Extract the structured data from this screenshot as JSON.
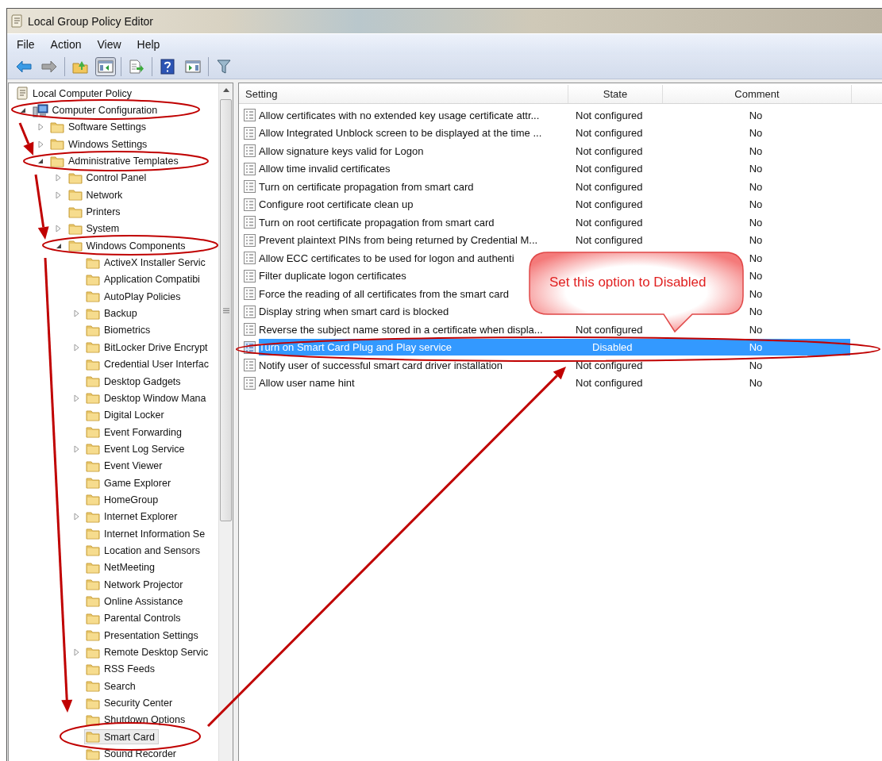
{
  "window": {
    "title": "Local Group Policy Editor"
  },
  "menu": [
    {
      "label": "File"
    },
    {
      "label": "Action"
    },
    {
      "label": "View"
    },
    {
      "label": "Help"
    }
  ],
  "toolbar": [
    [
      {
        "kind": "back",
        "pressed": false
      },
      {
        "kind": "forward",
        "pressed": false
      }
    ],
    [
      {
        "kind": "up",
        "pressed": false
      },
      {
        "kind": "tree",
        "pressed": true
      }
    ],
    [
      {
        "kind": "export",
        "pressed": false
      }
    ],
    [
      {
        "kind": "help",
        "pressed": false
      },
      {
        "kind": "pane",
        "pressed": false
      }
    ],
    [
      {
        "kind": "filter",
        "pressed": false
      }
    ]
  ],
  "tree": [
    {
      "label": "Local Computer Policy",
      "kind": "policy",
      "selected": false,
      "children": [
        {
          "label": "Computer Configuration",
          "kind": "computer",
          "expanded": true,
          "selected": false,
          "children": [
            {
              "label": "Software Settings",
              "kind": "folder",
              "expanded": false,
              "selected": false
            },
            {
              "label": "Windows Settings",
              "kind": "folder",
              "expanded": false,
              "selected": false
            },
            {
              "label": "Administrative Templates",
              "kind": "folder",
              "expanded": true,
              "selected": false,
              "children": [
                {
                  "label": "Control Panel",
                  "kind": "folder",
                  "expanded": false,
                  "selected": false
                },
                {
                  "label": "Network",
                  "kind": "folder",
                  "expanded": false,
                  "selected": false
                },
                {
                  "label": "Printers",
                  "kind": "folder",
                  "selected": false
                },
                {
                  "label": "System",
                  "kind": "folder",
                  "expanded": false,
                  "selected": false
                },
                {
                  "label": "Windows Components",
                  "kind": "folder",
                  "expanded": true,
                  "selected": false,
                  "children": [
                    {
                      "label": "ActiveX Installer Servic",
                      "kind": "folder",
                      "selected": false
                    },
                    {
                      "label": "Application Compatibi",
                      "kind": "folder",
                      "selected": false
                    },
                    {
                      "label": "AutoPlay Policies",
                      "kind": "folder",
                      "selected": false
                    },
                    {
                      "label": "Backup",
                      "kind": "folder",
                      "expanded": false,
                      "selected": false
                    },
                    {
                      "label": "Biometrics",
                      "kind": "folder",
                      "selected": false
                    },
                    {
                      "label": "BitLocker Drive Encrypt",
                      "kind": "folder",
                      "expanded": false,
                      "selected": false
                    },
                    {
                      "label": "Credential User Interfac",
                      "kind": "folder",
                      "selected": false
                    },
                    {
                      "label": "Desktop Gadgets",
                      "kind": "folder",
                      "selected": false
                    },
                    {
                      "label": "Desktop Window Mana",
                      "kind": "folder",
                      "expanded": false,
                      "selected": false
                    },
                    {
                      "label": "Digital Locker",
                      "kind": "folder",
                      "selected": false
                    },
                    {
                      "label": "Event Forwarding",
                      "kind": "folder",
                      "selected": false
                    },
                    {
                      "label": "Event Log Service",
                      "kind": "folder",
                      "expanded": false,
                      "selected": false
                    },
                    {
                      "label": "Event Viewer",
                      "kind": "folder",
                      "selected": false
                    },
                    {
                      "label": "Game Explorer",
                      "kind": "folder",
                      "selected": false
                    },
                    {
                      "label": "HomeGroup",
                      "kind": "folder",
                      "selected": false
                    },
                    {
                      "label": "Internet Explorer",
                      "kind": "folder",
                      "expanded": false,
                      "selected": false
                    },
                    {
                      "label": "Internet Information Se",
                      "kind": "folder",
                      "selected": false
                    },
                    {
                      "label": "Location and Sensors",
                      "kind": "folder",
                      "selected": false
                    },
                    {
                      "label": "NetMeeting",
                      "kind": "folder",
                      "selected": false
                    },
                    {
                      "label": "Network Projector",
                      "kind": "folder",
                      "selected": false
                    },
                    {
                      "label": "Online Assistance",
                      "kind": "folder",
                      "selected": false
                    },
                    {
                      "label": "Parental Controls",
                      "kind": "folder",
                      "selected": false
                    },
                    {
                      "label": "Presentation Settings",
                      "kind": "folder",
                      "selected": false
                    },
                    {
                      "label": "Remote Desktop Servic",
                      "kind": "folder",
                      "expanded": false,
                      "selected": false
                    },
                    {
                      "label": "RSS Feeds",
                      "kind": "folder",
                      "selected": false
                    },
                    {
                      "label": "Search",
                      "kind": "folder",
                      "selected": false
                    },
                    {
                      "label": "Security Center",
                      "kind": "folder",
                      "selected": false
                    },
                    {
                      "label": "Shutdown Options",
                      "kind": "folder",
                      "selected": false
                    },
                    {
                      "label": "Smart Card",
                      "kind": "folder",
                      "selected": true
                    },
                    {
                      "label": "Sound Recorder",
                      "kind": "folder",
                      "selected": false
                    }
                  ]
                }
              ]
            }
          ]
        }
      ]
    }
  ],
  "table": {
    "columns": [
      "Setting",
      "State",
      "Comment"
    ],
    "rows": [
      {
        "setting": "Allow certificates with no extended key usage certificate attr...",
        "state": "Not configured",
        "comment": "No",
        "selected": false
      },
      {
        "setting": "Allow Integrated Unblock screen to be displayed at the time ...",
        "state": "Not configured",
        "comment": "No",
        "selected": false
      },
      {
        "setting": "Allow signature keys valid for Logon",
        "state": "Not configured",
        "comment": "No",
        "selected": false
      },
      {
        "setting": "Allow time invalid certificates",
        "state": "Not configured",
        "comment": "No",
        "selected": false
      },
      {
        "setting": "Turn on certificate propagation from smart card",
        "state": "Not configured",
        "comment": "No",
        "selected": false
      },
      {
        "setting": "Configure root certificate clean up",
        "state": "Not configured",
        "comment": "No",
        "selected": false
      },
      {
        "setting": "Turn on root certificate propagation from smart card",
        "state": "Not configured",
        "comment": "No",
        "selected": false
      },
      {
        "setting": "Prevent plaintext PINs from being returned by Credential M...",
        "state": "Not configured",
        "comment": "No",
        "selected": false
      },
      {
        "setting": "Allow ECC certificates to be used for logon and authenti",
        "comment": "No",
        "selected": false
      },
      {
        "setting": "Filter duplicate logon certificates",
        "comment": "No",
        "selected": false
      },
      {
        "setting": "Force the reading of all certificates from the smart card",
        "comment": "No",
        "selected": false
      },
      {
        "setting": "Display string when smart card is blocked",
        "comment": "No",
        "selected": false
      },
      {
        "setting": "Reverse the subject name stored in a certificate when displa...",
        "state": "Not configured",
        "comment": "No",
        "selected": false
      },
      {
        "setting": "Turn on Smart Card Plug and Play service",
        "state": "Disabled",
        "comment": "No",
        "selected": true
      },
      {
        "setting": "Notify user of successful smart card driver installation",
        "state": "Not configured",
        "comment": "No",
        "selected": false
      },
      {
        "setting": "Allow user name hint",
        "state": "Not configured",
        "comment": "No",
        "selected": false
      }
    ]
  },
  "callout": {
    "text": "Set this option to Disabled"
  }
}
